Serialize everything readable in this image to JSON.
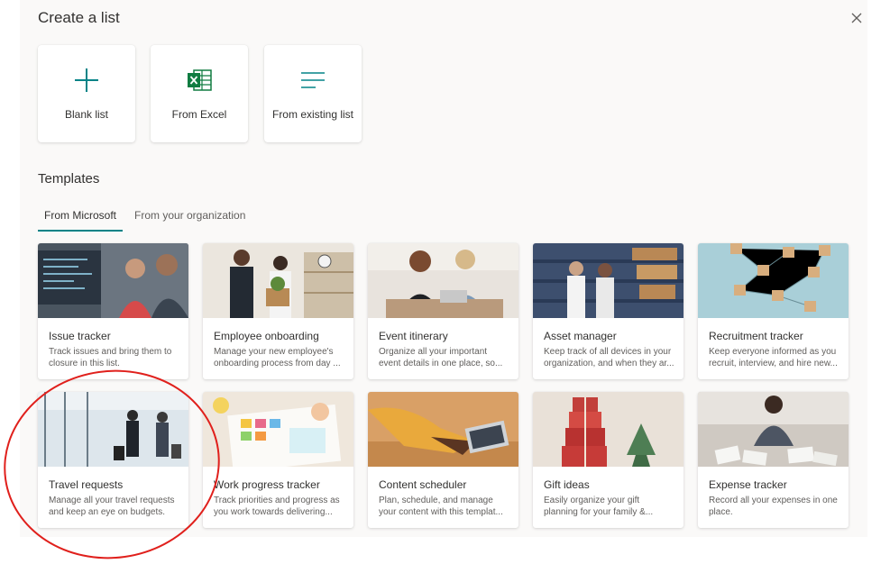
{
  "dialog": {
    "title": "Create a list",
    "close_icon": "close-icon"
  },
  "create_options": [
    {
      "label": "Blank list",
      "icon": "plus-icon"
    },
    {
      "label": "From Excel",
      "icon": "excel-icon"
    },
    {
      "label": "From existing list",
      "icon": "lines-icon"
    }
  ],
  "templates": {
    "heading": "Templates",
    "tabs": [
      {
        "label": "From Microsoft",
        "selected": true
      },
      {
        "label": "From your organization",
        "selected": false
      }
    ],
    "cards": [
      {
        "name": "Issue tracker",
        "desc": "Track issues and bring them to closure in this list."
      },
      {
        "name": "Employee onboarding",
        "desc": "Manage your new employee's onboarding process from day ..."
      },
      {
        "name": "Event itinerary",
        "desc": "Organize all your important event details in one place, so..."
      },
      {
        "name": "Asset manager",
        "desc": "Keep track of all devices in your organization, and when they ar..."
      },
      {
        "name": "Recruitment tracker",
        "desc": "Keep everyone informed as you recruit, interview, and hire new..."
      },
      {
        "name": "Travel requests",
        "desc": "Manage all your travel requests and keep an eye on budgets."
      },
      {
        "name": "Work progress tracker",
        "desc": "Track priorities and progress as you work towards delivering..."
      },
      {
        "name": "Content scheduler",
        "desc": "Plan, schedule, and manage your content with this templat..."
      },
      {
        "name": "Gift ideas",
        "desc": "Easily organize your gift planning for your family &..."
      },
      {
        "name": "Expense tracker",
        "desc": "Record all your expenses in one place."
      }
    ]
  },
  "colors": {
    "accent": "#038387",
    "excel_green": "#107c41",
    "highlight_circle": "#e0201c"
  }
}
